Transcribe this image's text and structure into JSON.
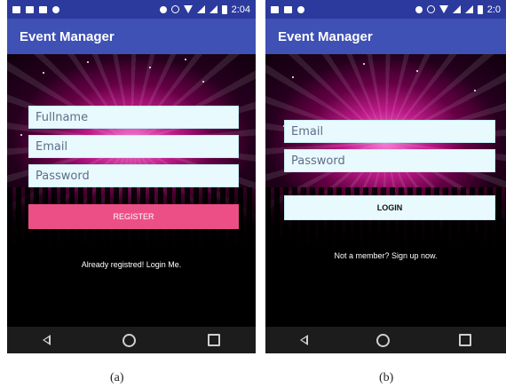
{
  "screen_a": {
    "status_time": "2:04",
    "app_title": "Event Manager",
    "fields": [
      {
        "placeholder": "Fullname"
      },
      {
        "placeholder": "Email"
      },
      {
        "placeholder": "Password"
      }
    ],
    "register_label": "REGISTER",
    "link_text": "Already registred! Login Me.",
    "caption": "(a)"
  },
  "screen_b": {
    "status_time": "2:0",
    "app_title": "Event Manager",
    "fields": [
      {
        "placeholder": "Email"
      },
      {
        "placeholder": "Password"
      }
    ],
    "login_label": "LOGIN",
    "link_text": "Not a member? Sign up now.",
    "caption": "(b)"
  },
  "colors": {
    "statusbar": "#2b3a9c",
    "appbar": "#3f51b5",
    "register_button": "#ec4f86",
    "field_background": "#e8fafd"
  },
  "icons": [
    "back-icon",
    "home-icon",
    "recents-icon",
    "wifi-icon",
    "signal-icon",
    "battery-icon",
    "alarm-icon"
  ]
}
